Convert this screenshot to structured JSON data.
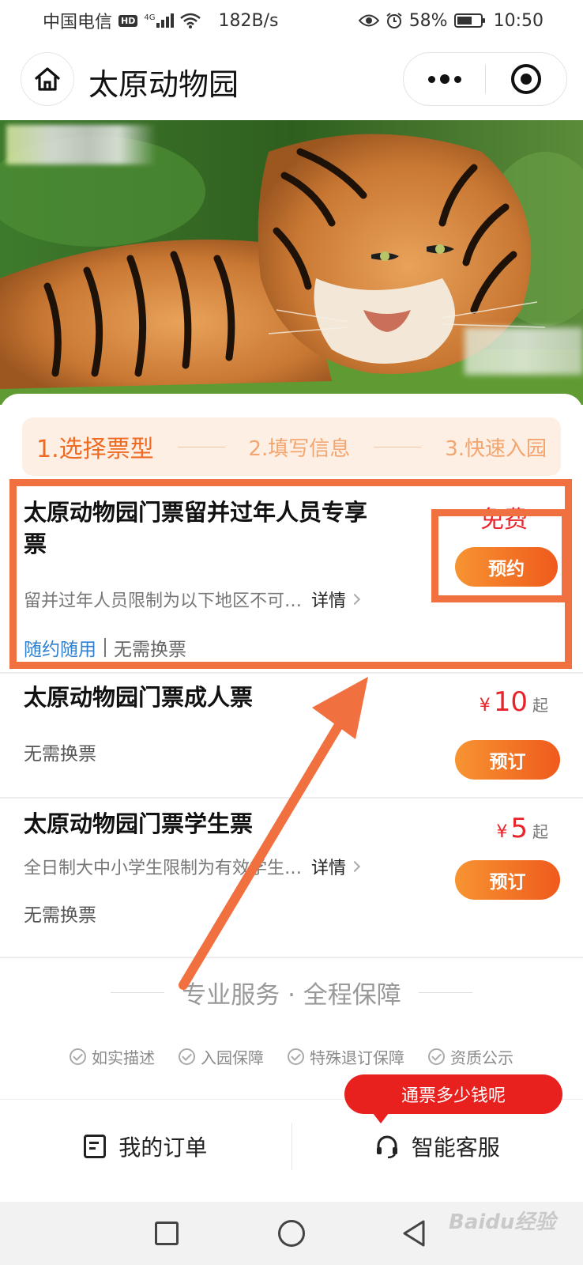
{
  "status_bar": {
    "carrier": "中国电信",
    "hd": "HD",
    "network": "4G",
    "speed": "182B/s",
    "battery": "58%",
    "time": "10:50"
  },
  "nav": {
    "title": "太原动物园"
  },
  "steps": {
    "step1": "1.选择票型",
    "step2": "2.填写信息",
    "step3": "3.快速入园"
  },
  "tickets": [
    {
      "title_line1": "太原动物园门票留并过年人员专享",
      "title_line2": "票",
      "price_text": "免费",
      "button": "预约",
      "desc": "留并过年人员限制为以下地区不可…",
      "detail": "详情",
      "tag_primary": "随约随用",
      "tag_secondary": "无需换票"
    },
    {
      "title": "太原动物园门票成人票",
      "currency": "¥",
      "price": "10",
      "price_suffix": "起",
      "button": "预订",
      "note": "无需换票"
    },
    {
      "title": "太原动物园门票学生票",
      "currency": "¥",
      "price": "5",
      "price_suffix": "起",
      "button": "预订",
      "desc": "全日制大中小学生限制为有效学生…",
      "detail": "详情",
      "note": "无需换票"
    }
  ],
  "service": {
    "title": "专业服务 · 全程保障",
    "items": [
      "如实描述",
      "入园保障",
      "特殊退订保障",
      "资质公示"
    ]
  },
  "bottom_bar": {
    "orders": "我的订单",
    "support": "智能客服",
    "bubble": "通票多少钱呢"
  },
  "watermark": "Baidu经验",
  "colors": {
    "accent_orange": "#ef6b23",
    "price_red": "#e8242a",
    "annotation": "#f07040",
    "link_blue": "#2f7fd0"
  }
}
